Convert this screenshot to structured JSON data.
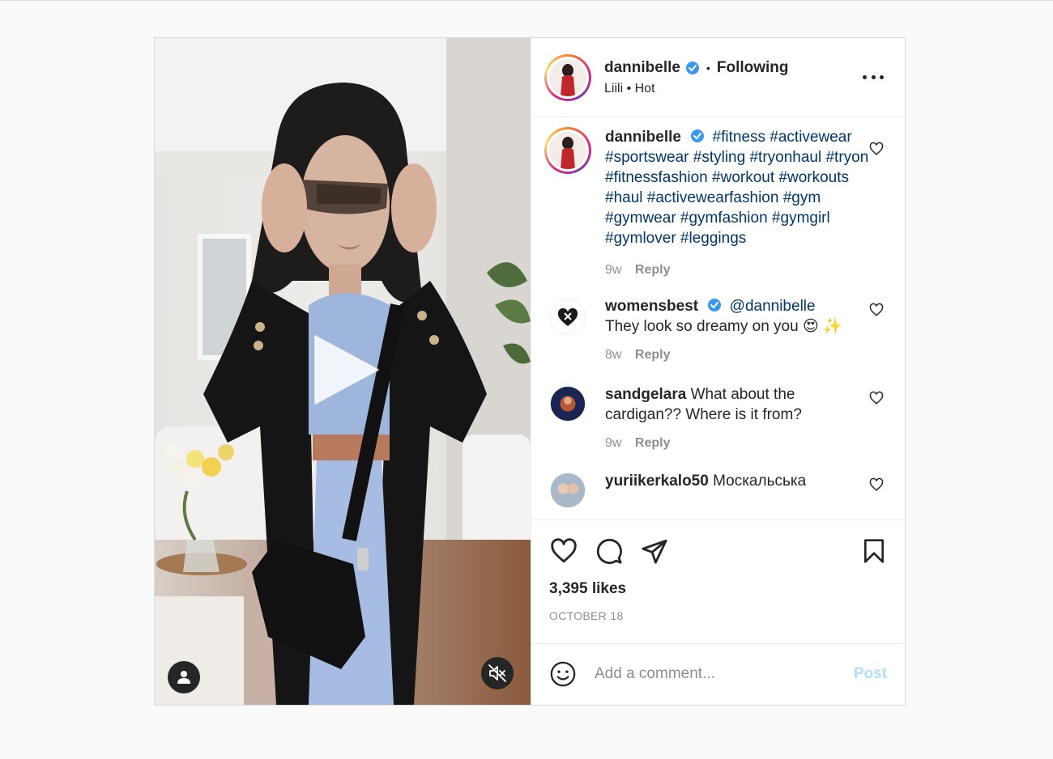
{
  "post": {
    "author": "dannibelle",
    "separator": "•",
    "follow_status": "Following",
    "audio": "Liili • Hot"
  },
  "comments": [
    {
      "user": "dannibelle",
      "verified": true,
      "text": "#fitness #activewear #sportswear #styling #tryonhaul #tryon #fitnessfashion #workout #workouts #haul #activewearfashion #gym #gymwear #gymfashion #gymgirl #gymlover #leggings",
      "age": "9w",
      "reply_label": "Reply"
    },
    {
      "user": "womensbest",
      "verified": true,
      "mention": "@dannibelle",
      "text": "They look so dreamy on you 😍 ✨",
      "age": "8w",
      "reply_label": "Reply"
    },
    {
      "user": "sandgelara",
      "verified": false,
      "text": "What about the cardigan?? Where is it from?",
      "age": "9w",
      "reply_label": "Reply"
    },
    {
      "user": "yuriikerkalo50",
      "verified": false,
      "text": "Москальська",
      "age": "",
      "reply_label": ""
    }
  ],
  "stats": {
    "likes": "3,395 likes",
    "date": "OCTOBER 18"
  },
  "comment_box": {
    "placeholder": "Add a comment...",
    "post_label": "Post"
  },
  "icons": {
    "more": "more-options-icon",
    "like": "heart-icon",
    "comment": "comment-bubble-icon",
    "share": "paper-plane-icon",
    "save": "bookmark-icon",
    "emoji": "emoji-icon",
    "play": "play-icon",
    "user_tag": "user-tag-icon",
    "mute": "speaker-muted-icon",
    "verified": "verified-badge-icon"
  },
  "colors": {
    "link": "#00376b",
    "verified": "#3897f0",
    "post_disabled": "#b2dffc",
    "muted_text": "#8e8e8e"
  }
}
